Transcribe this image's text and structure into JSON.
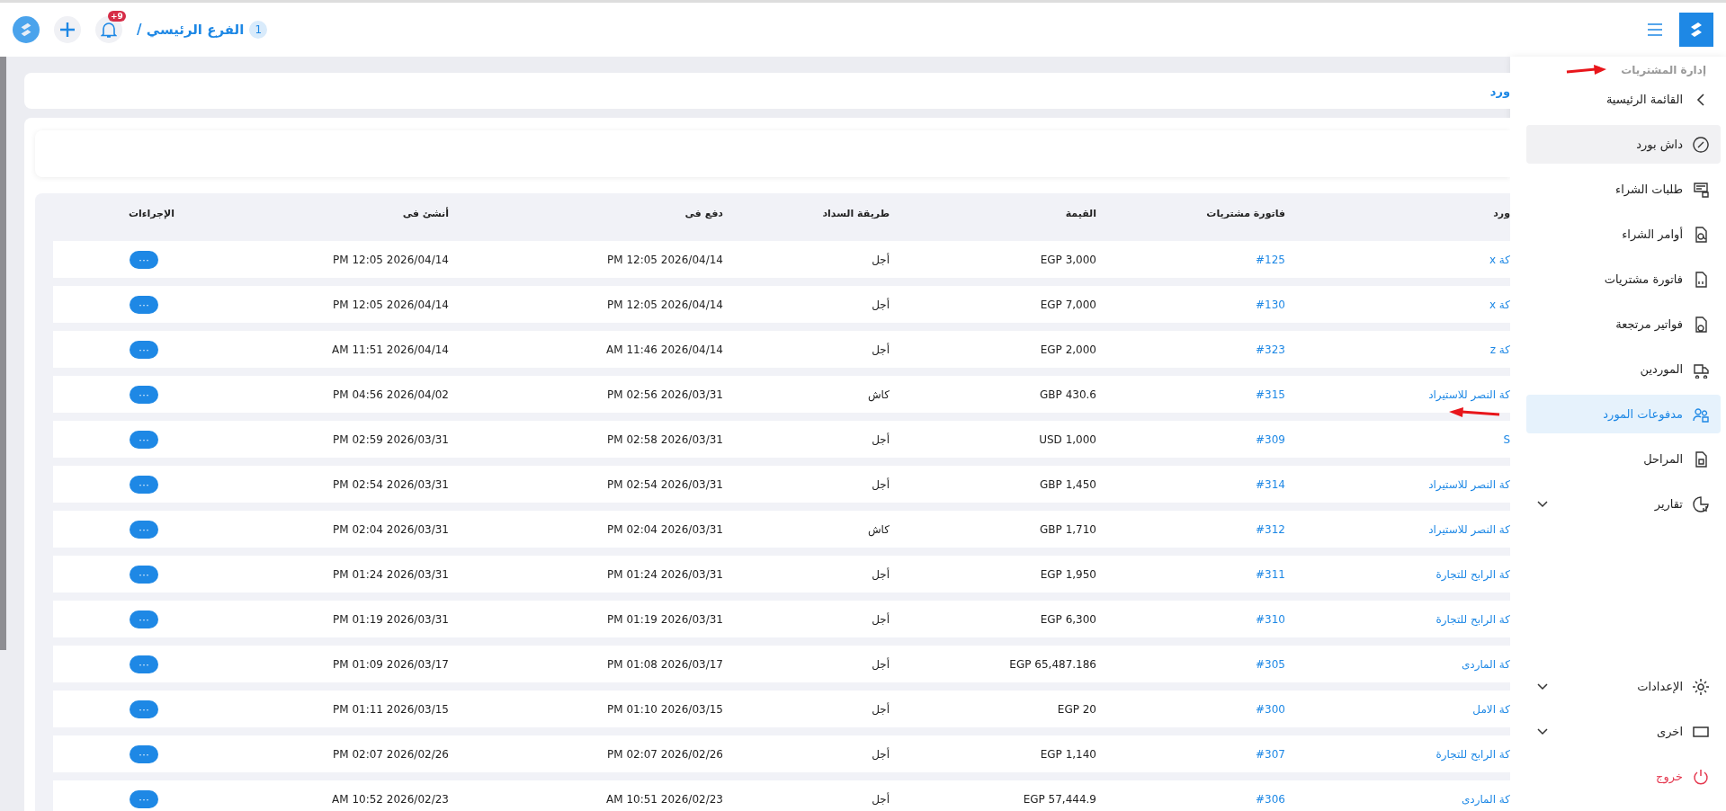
{
  "topbar": {
    "breadcrumb_badge": "1",
    "breadcrumb": "الفرع الرئيسي /",
    "notification_count": "+9"
  },
  "page_title": "ورد",
  "table": {
    "columns": [
      "ورد",
      "فاتورة مشتريات",
      "القيمة",
      "طريقة السداد",
      "دفع فى",
      "أنشئ فى",
      "الإجراءات"
    ],
    "rows": [
      {
        "supplier": "كة x",
        "invoice": "#125",
        "value": "EGP 3,000",
        "method": "أجل",
        "paid_at": "2026/04/14 12:05 PM",
        "created_at": "2026/04/14 12:05 PM",
        "action": "···"
      },
      {
        "supplier": "كة x",
        "invoice": "#130",
        "value": "EGP 7,000",
        "method": "أجل",
        "paid_at": "2026/04/14 12:05 PM",
        "created_at": "2026/04/14 12:05 PM",
        "action": "···"
      },
      {
        "supplier": "كة z",
        "invoice": "#323",
        "value": "EGP 2,000",
        "method": "أجل",
        "paid_at": "2026/04/14 11:46 AM",
        "created_at": "2026/04/14 11:51 AM",
        "action": "···"
      },
      {
        "supplier": "كة النصر للاستيراد",
        "invoice": "#315",
        "value": "GBP 430.6",
        "method": "كاش",
        "paid_at": "2026/03/31 02:56 PM",
        "created_at": "2026/04/02 04:56 PM",
        "action": "···"
      },
      {
        "supplier": "S",
        "invoice": "#309",
        "value": "USD 1,000",
        "method": "أجل",
        "paid_at": "2026/03/31 02:58 PM",
        "created_at": "2026/03/31 02:59 PM",
        "action": "···"
      },
      {
        "supplier": "كة النصر للاستيراد",
        "invoice": "#314",
        "value": "GBP 1,450",
        "method": "أجل",
        "paid_at": "2026/03/31 02:54 PM",
        "created_at": "2026/03/31 02:54 PM",
        "action": "···"
      },
      {
        "supplier": "كة النصر للاستيراد",
        "invoice": "#312",
        "value": "GBP 1,710",
        "method": "كاش",
        "paid_at": "2026/03/31 02:04 PM",
        "created_at": "2026/03/31 02:04 PM",
        "action": "···"
      },
      {
        "supplier": "كة الرابح للتجارة",
        "invoice": "#311",
        "value": "EGP 1,950",
        "method": "أجل",
        "paid_at": "2026/03/31 01:24 PM",
        "created_at": "2026/03/31 01:24 PM",
        "action": "···"
      },
      {
        "supplier": "كة الرابح للتجارة",
        "invoice": "#310",
        "value": "EGP 6,300",
        "method": "أجل",
        "paid_at": "2026/03/31 01:19 PM",
        "created_at": "2026/03/31 01:19 PM",
        "action": "···"
      },
      {
        "supplier": "كة الماردى",
        "invoice": "#305",
        "value": "EGP 65,487.186",
        "method": "أجل",
        "paid_at": "2026/03/17 01:08 PM",
        "created_at": "2026/03/17 01:09 PM",
        "action": "···"
      },
      {
        "supplier": "كة الامل",
        "invoice": "#300",
        "value": "EGP 20",
        "method": "أجل",
        "paid_at": "2026/03/15 01:10 PM",
        "created_at": "2026/03/15 01:11 PM",
        "action": "···"
      },
      {
        "supplier": "كة الرابح للتجارة",
        "invoice": "#307",
        "value": "EGP 1,140",
        "method": "أجل",
        "paid_at": "2026/02/26 02:07 PM",
        "created_at": "2026/02/26 02:07 PM",
        "action": "···"
      },
      {
        "supplier": "كة الماردى",
        "invoice": "#306",
        "value": "EGP 57,444.9",
        "method": "أجل",
        "paid_at": "2026/02/23 10:51 AM",
        "created_at": "2026/02/23 10:52 AM",
        "action": "···"
      }
    ]
  },
  "sidebar": {
    "section_title": "إدارة المشتريات",
    "items": [
      {
        "kind": "back",
        "label": "القائمة الرئيسية",
        "selected": false,
        "highlighted": false
      },
      {
        "kind": "link",
        "label": "داش بورد",
        "selected": false,
        "highlighted": true
      },
      {
        "kind": "link",
        "label": "طلبات الشراء",
        "selected": false,
        "highlighted": false
      },
      {
        "kind": "link",
        "label": "أوامر الشراء",
        "selected": false,
        "highlighted": false
      },
      {
        "kind": "link",
        "label": "فاتورة مشتريات",
        "selected": false,
        "highlighted": false
      },
      {
        "kind": "link",
        "label": "فواتير مرتجعة",
        "selected": false,
        "highlighted": false
      },
      {
        "kind": "link",
        "label": "الموردين",
        "selected": false,
        "highlighted": false
      },
      {
        "kind": "link",
        "label": "مدفوعات المورد",
        "selected": true,
        "highlighted": false
      },
      {
        "kind": "link",
        "label": "المراحل",
        "selected": false,
        "highlighted": false
      },
      {
        "kind": "group",
        "label": "تقارير",
        "selected": false,
        "highlighted": false
      }
    ],
    "bottom_items": [
      {
        "kind": "group",
        "label": "الإعدادات"
      },
      {
        "kind": "group",
        "label": "اخرى"
      },
      {
        "kind": "logout",
        "label": "خروج"
      }
    ]
  }
}
